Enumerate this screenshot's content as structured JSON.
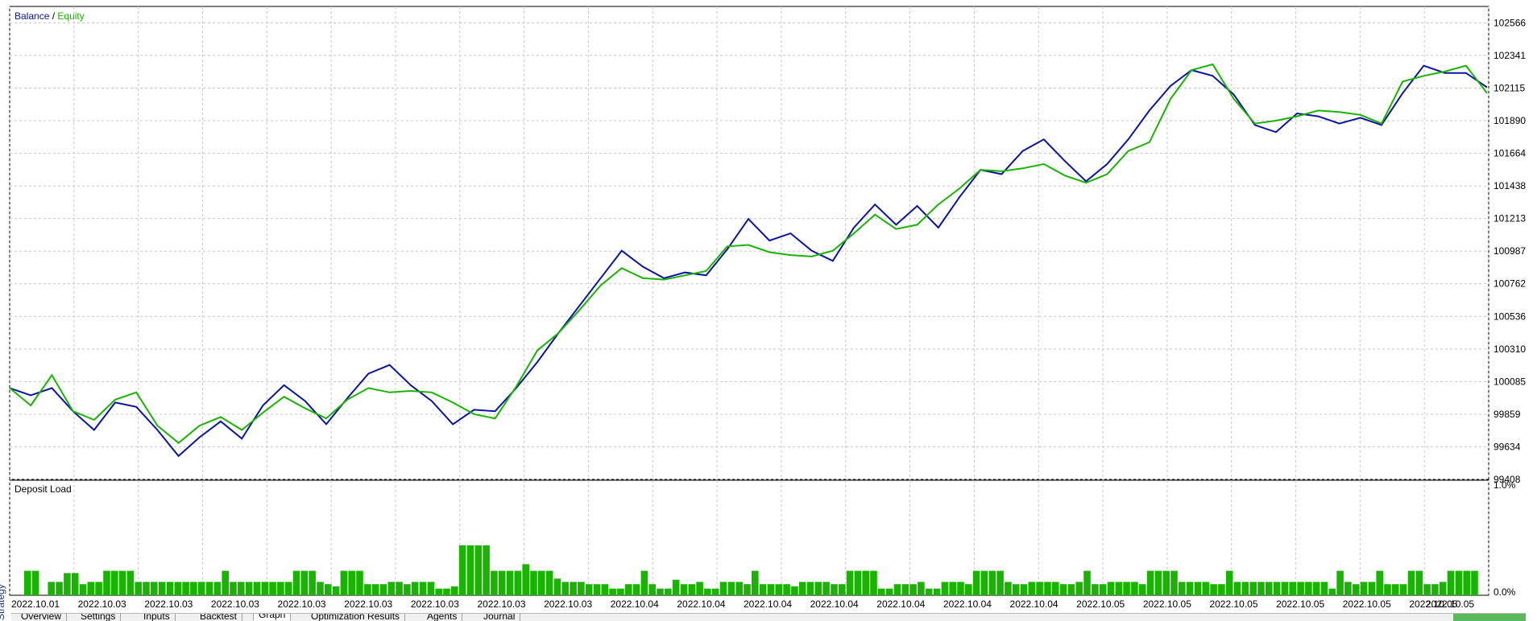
{
  "colors": {
    "balance": "#0a14a6",
    "equity": "#19b400",
    "load_bar": "#19b400",
    "grid": "#c8c8c8",
    "text": "#000000"
  },
  "sidebar_label": "Strategy Tester",
  "tabs": [
    "Overview",
    "Settings",
    "Inputs",
    "Backtest",
    "Graph",
    "Optimization Results",
    "Agents",
    "Journal"
  ],
  "active_tab": "Graph",
  "chart_data": [
    {
      "type": "line",
      "title": "Balance / Equity",
      "legend": [
        "Balance",
        "Equity"
      ],
      "legend_placement": "top-left",
      "grid": true,
      "y_ticks": [
        99408,
        99634,
        99859,
        100085,
        100310,
        100536,
        100762,
        100987,
        101213,
        101438,
        101664,
        101890,
        102115,
        102341,
        102566
      ],
      "ylim": [
        99408,
        102680
      ],
      "series": [
        {
          "name": "Balance",
          "values": [
            100040,
            99990,
            100040,
            99880,
            99750,
            99940,
            99910,
            99750,
            99570,
            99700,
            99810,
            99690,
            99920,
            100060,
            99950,
            99790,
            99970,
            100140,
            100200,
            100060,
            99950,
            99790,
            99890,
            99880,
            100040,
            100220,
            100420,
            100610,
            100800,
            100990,
            100880,
            100800,
            100840,
            100820,
            101000,
            101210,
            101060,
            101110,
            100990,
            100920,
            101150,
            101310,
            101170,
            101300,
            101150,
            101360,
            101550,
            101520,
            101680,
            101760,
            101610,
            101470,
            101590,
            101760,
            101960,
            102130,
            102240,
            102200,
            102070,
            101860,
            101810,
            101940,
            101920,
            101870,
            101910,
            101860,
            102080,
            102270,
            102220,
            102220,
            102120
          ]
        },
        {
          "name": "Equity",
          "values": [
            100040,
            99920,
            100130,
            99880,
            99820,
            99960,
            100010,
            99780,
            99660,
            99780,
            99840,
            99750,
            99870,
            99980,
            99900,
            99830,
            99960,
            100040,
            100010,
            100020,
            100010,
            99940,
            99860,
            99830,
            100050,
            100300,
            100420,
            100580,
            100750,
            100870,
            100800,
            100790,
            100820,
            100850,
            101020,
            101030,
            100980,
            100960,
            100950,
            100990,
            101110,
            101240,
            101140,
            101170,
            101310,
            101420,
            101550,
            101540,
            101560,
            101590,
            101510,
            101460,
            101520,
            101680,
            101740,
            102040,
            102240,
            102280,
            102040,
            101870,
            101890,
            101920,
            101960,
            101950,
            101930,
            101870,
            102160,
            102200,
            102230,
            102270,
            102080
          ]
        }
      ],
      "x_labels": [
        "2022.10.01",
        "2022.10.03",
        "2022.10.03",
        "2022.10.03",
        "2022.10.03",
        "2022.10.03",
        "2022.10.03",
        "2022.10.03",
        "2022.10.03",
        "2022.10.04",
        "2022.10.04",
        "2022.10.04",
        "2022.10.04",
        "2022.10.04",
        "2022.10.04",
        "2022.10.04",
        "2022.10.05",
        "2022.10.05",
        "2022.10.05",
        "2022.10.05",
        "2022.10.05",
        "2022.10.05",
        "2022.10.05"
      ]
    },
    {
      "type": "bar",
      "title": "Deposit Load",
      "y_ticks": [
        "1.0%",
        "0.0%"
      ],
      "ylim": [
        0,
        1.0
      ],
      "values": [
        0.22,
        0.22,
        0.0,
        0.12,
        0.12,
        0.2,
        0.2,
        0.1,
        0.12,
        0.12,
        0.22,
        0.22,
        0.22,
        0.22,
        0.12,
        0.12,
        0.12,
        0.12,
        0.12,
        0.12,
        0.12,
        0.12,
        0.12,
        0.12,
        0.12,
        0.22,
        0.12,
        0.12,
        0.12,
        0.12,
        0.12,
        0.12,
        0.12,
        0.12,
        0.22,
        0.22,
        0.22,
        0.12,
        0.1,
        0.08,
        0.22,
        0.22,
        0.22,
        0.1,
        0.1,
        0.1,
        0.12,
        0.12,
        0.1,
        0.12,
        0.12,
        0.12,
        0.06,
        0.06,
        0.08,
        0.45,
        0.45,
        0.45,
        0.45,
        0.22,
        0.22,
        0.22,
        0.22,
        0.28,
        0.22,
        0.22,
        0.22,
        0.15,
        0.12,
        0.12,
        0.12,
        0.1,
        0.1,
        0.1,
        0.06,
        0.06,
        0.1,
        0.1,
        0.22,
        0.1,
        0.06,
        0.06,
        0.14,
        0.1,
        0.1,
        0.12,
        0.06,
        0.06,
        0.12,
        0.12,
        0.12,
        0.1,
        0.22,
        0.1,
        0.1,
        0.1,
        0.1,
        0.08,
        0.12,
        0.12,
        0.12,
        0.12,
        0.1,
        0.1,
        0.22,
        0.22,
        0.22,
        0.22,
        0.06,
        0.06,
        0.1,
        0.1,
        0.1,
        0.12,
        0.06,
        0.06,
        0.12,
        0.12,
        0.12,
        0.1,
        0.22,
        0.22,
        0.22,
        0.22,
        0.12,
        0.1,
        0.1,
        0.12,
        0.12,
        0.12,
        0.12,
        0.1,
        0.1,
        0.12,
        0.22,
        0.1,
        0.1,
        0.12,
        0.12,
        0.12,
        0.12,
        0.1,
        0.22,
        0.22,
        0.22,
        0.22,
        0.12,
        0.12,
        0.12,
        0.12,
        0.1,
        0.1,
        0.22,
        0.12,
        0.12,
        0.12,
        0.12,
        0.12,
        0.12,
        0.12,
        0.12,
        0.12,
        0.12,
        0.12,
        0.12,
        0.06,
        0.22,
        0.12,
        0.1,
        0.12,
        0.12,
        0.22,
        0.1,
        0.1,
        0.1,
        0.22,
        0.22,
        0.1,
        0.1,
        0.12,
        0.22,
        0.22,
        0.22,
        0.22
      ]
    }
  ]
}
